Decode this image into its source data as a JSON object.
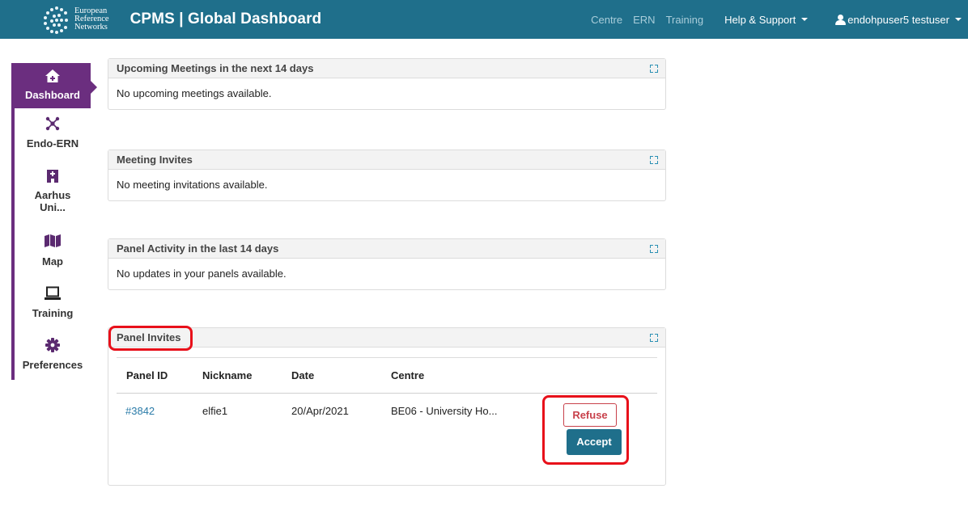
{
  "header": {
    "logo_lines": [
      "European",
      "Reference",
      "Networks"
    ],
    "app_title": "CPMS | Global Dashboard",
    "nav_links": [
      "Centre",
      "ERN",
      "Training"
    ],
    "help_label": "Help & Support",
    "user_label": "endohpuser5 testuser"
  },
  "sidebar": {
    "items": [
      {
        "label": "Dashboard",
        "icon": "home-icon",
        "active": true
      },
      {
        "label": "Endo-ERN",
        "icon": "network-icon",
        "active": false
      },
      {
        "label_lines": [
          "Aarhus",
          "Uni..."
        ],
        "icon": "hospital-icon",
        "active": false
      },
      {
        "label": "Map",
        "icon": "map-icon",
        "active": false
      },
      {
        "label": "Training",
        "icon": "laptop-icon",
        "active": false
      },
      {
        "label": "Preferences",
        "icon": "gear-icon",
        "active": false
      }
    ]
  },
  "panels": {
    "meetings": {
      "title": "Upcoming Meetings in the next 14 days",
      "message": "No upcoming meetings available."
    },
    "meeting_invites": {
      "title": "Meeting Invites",
      "message": "No meeting invitations available."
    },
    "activity": {
      "title": "Panel Activity in the last 14 days",
      "message": "No updates in your panels available."
    },
    "panel_invites": {
      "title": "Panel Invites",
      "columns": [
        "Panel ID",
        "Nickname",
        "Date",
        "Centre"
      ],
      "rows": [
        {
          "panel_id": "#3842",
          "nickname": "elfie1",
          "date": "20/Apr/2021",
          "centre": "BE06 - University Ho...",
          "refuse_label": "Refuse",
          "accept_label": "Accept"
        }
      ]
    }
  },
  "colors": {
    "navbar": "#1f6f8b",
    "sidebar_accent": "#6b2e7f",
    "refuse": "#c8414b",
    "annotation": "#e8101a"
  }
}
